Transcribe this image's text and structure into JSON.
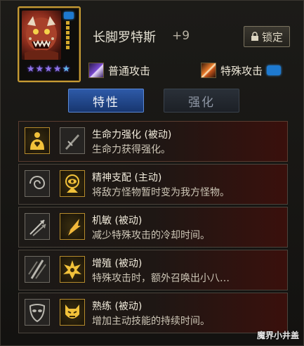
{
  "character": {
    "name": "长脚罗特斯",
    "level": "+9",
    "stars": [
      "★",
      "★",
      "★",
      "★",
      "★"
    ]
  },
  "lock_button": {
    "label": "锁定",
    "icon": "lock-icon"
  },
  "attacks": {
    "normal": {
      "label": "普通攻击",
      "icon": "claw-slash-icon"
    },
    "special": {
      "label": "特殊攻击",
      "icon": "fire-slash-icon"
    }
  },
  "tabs": [
    {
      "label": "特性",
      "active": true
    },
    {
      "label": "强化",
      "active": false
    }
  ],
  "skills": [
    {
      "title": "生命力强化 (被动)",
      "desc": "生命力获得强化。",
      "icon1": "heart-figure-icon",
      "icon2": "sword-icon"
    },
    {
      "title": "精神支配 (主动)",
      "desc": "将敌方怪物暂时变为我方怪物。",
      "icon1": "swirl-icon",
      "icon2": "eye-icon"
    },
    {
      "title": "机敏 (被动)",
      "desc": "减少特殊攻击的冷却时间。",
      "icon1": "arrows-icon",
      "icon2": "lightning-arrow-icon"
    },
    {
      "title": "增殖 (被动)",
      "desc": "特殊攻击时，额外召唤出小八…",
      "icon1": "slash-icon",
      "icon2": "burst-icon"
    },
    {
      "title": "熟练 (被动)",
      "desc": "增加主动技能的持续时间。",
      "icon1": "mask-icon",
      "icon2": "demon-face-icon"
    }
  ],
  "watermark": "魔界小井盖",
  "colors": {
    "gold": "#c49a34",
    "tab_active": "#2e5aa8",
    "star": "#8f74e6",
    "element": "#1e7ad0"
  }
}
